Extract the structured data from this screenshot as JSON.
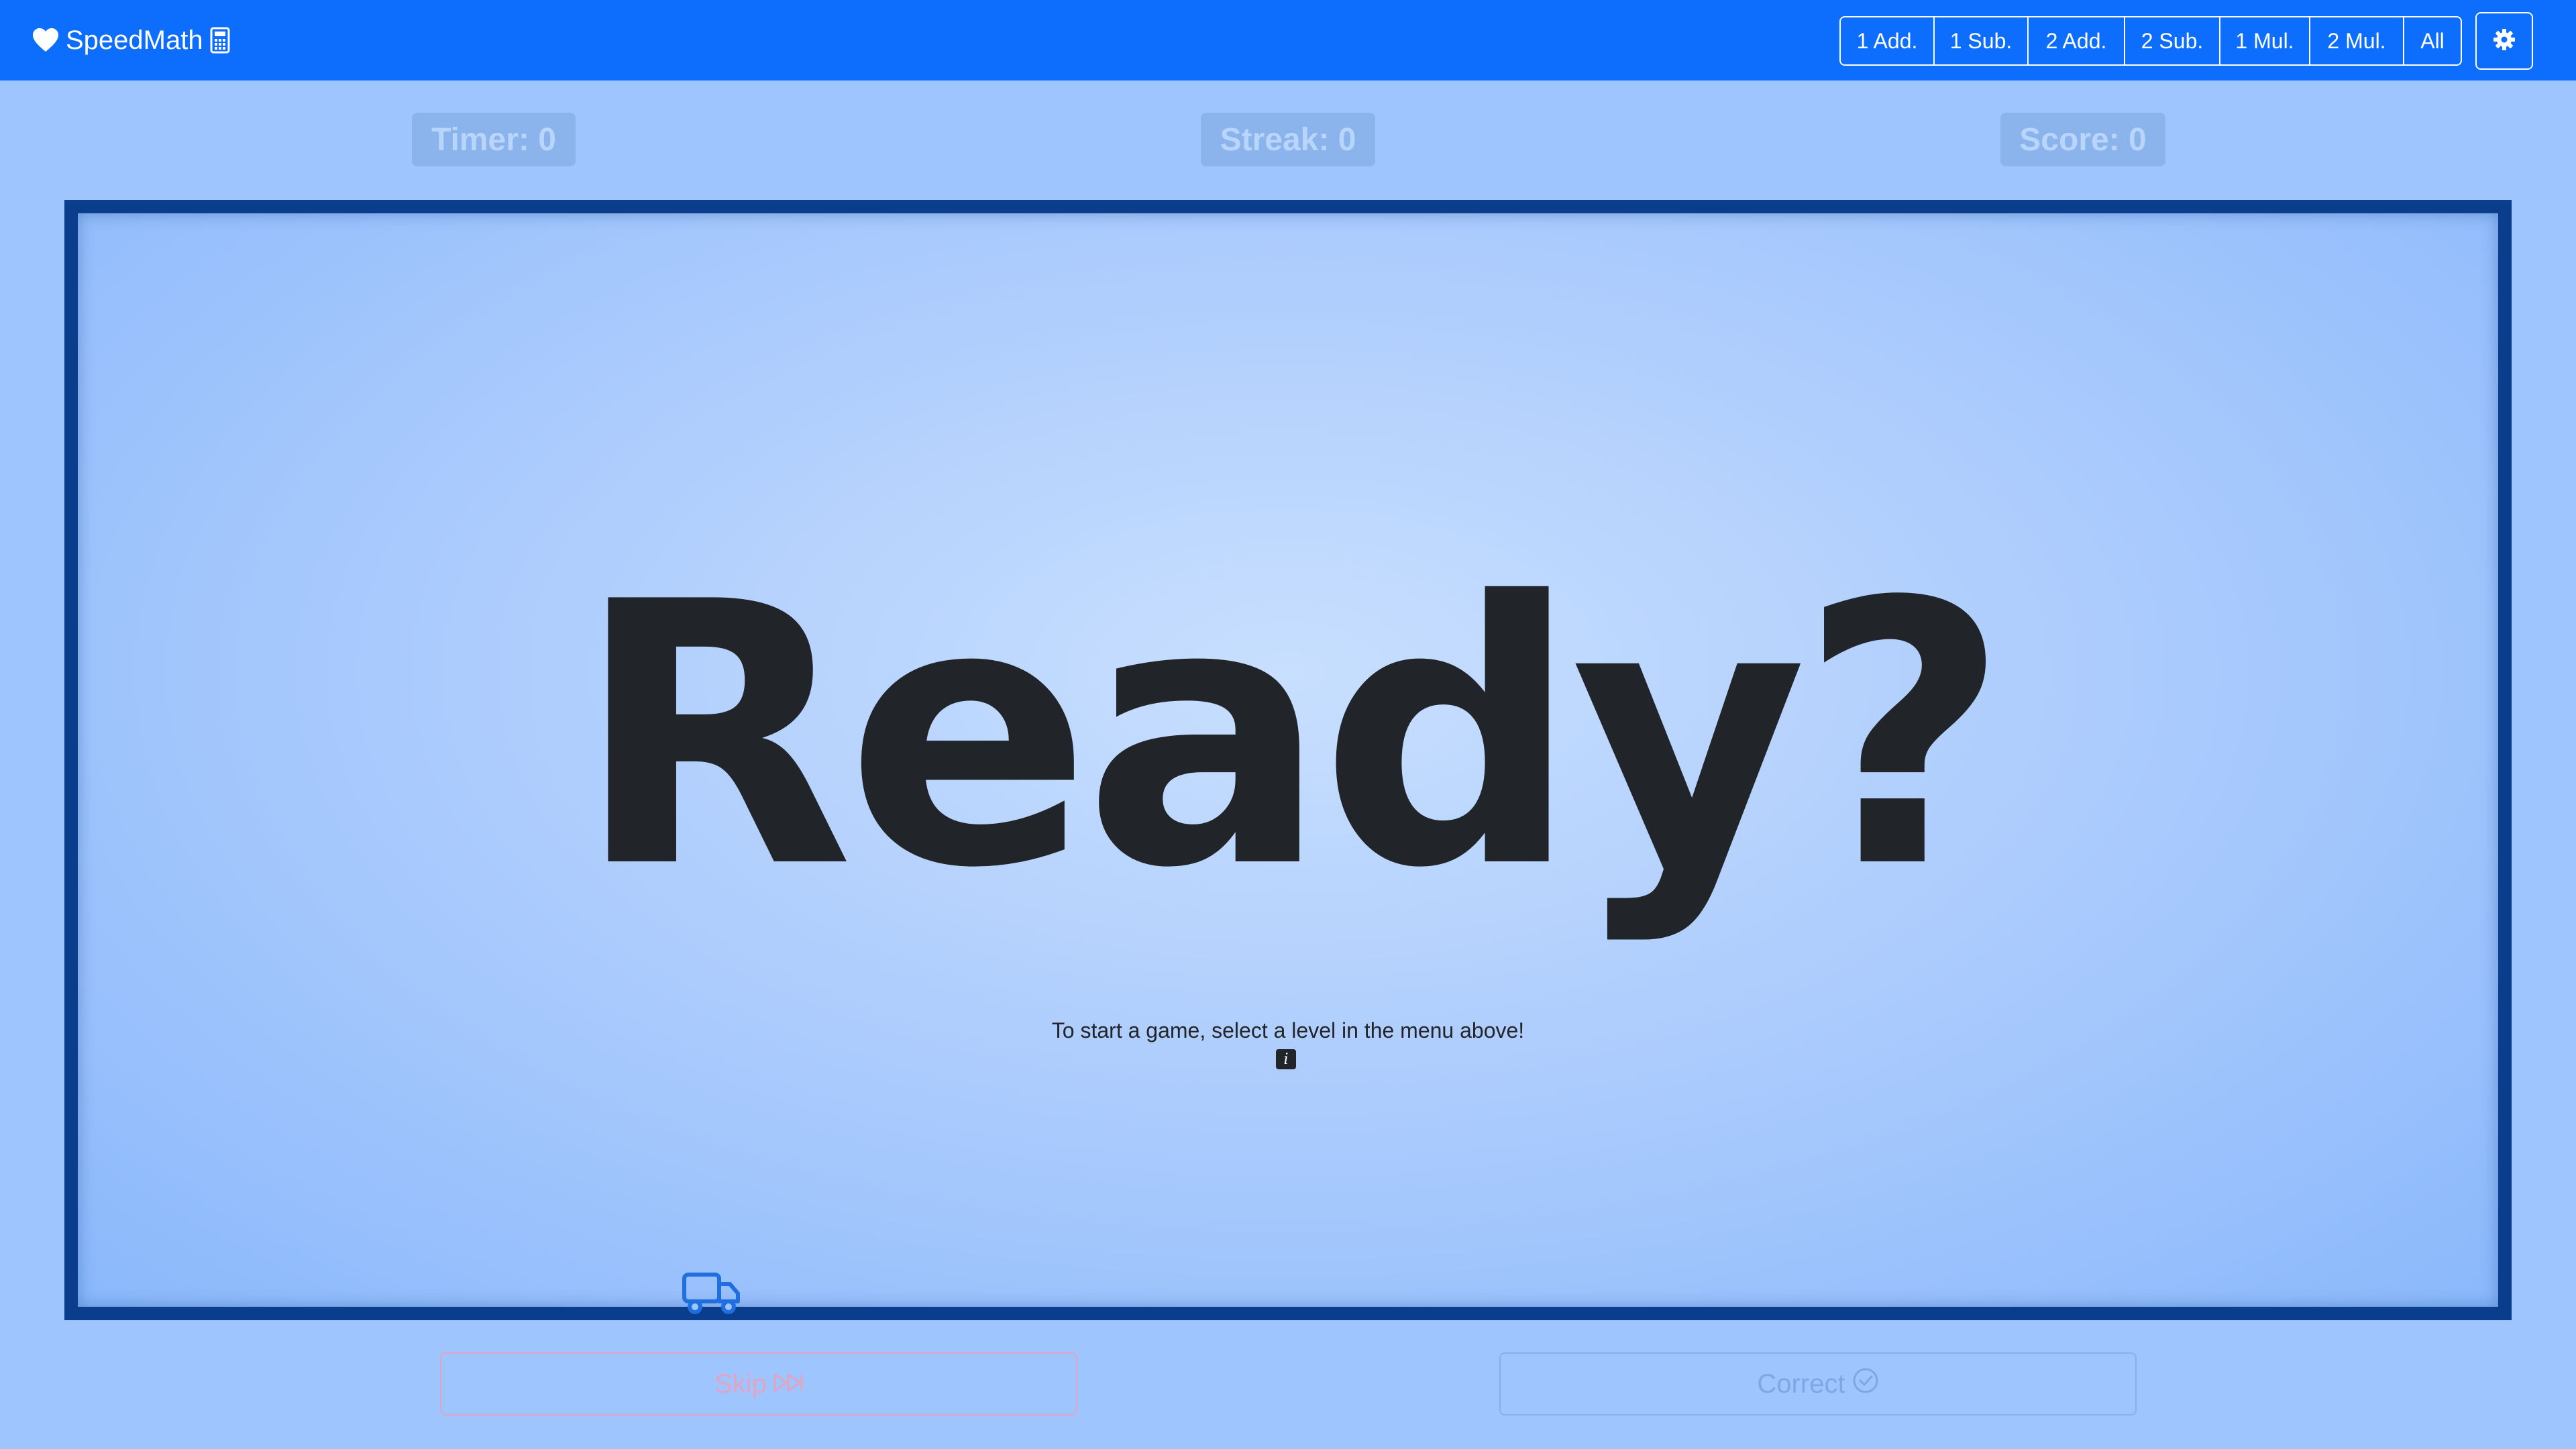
{
  "navbar": {
    "brand_label": "SpeedMath",
    "brand_icons": [
      "heart-icon",
      "calculator-icon"
    ],
    "levels": [
      {
        "label": "1 Add."
      },
      {
        "label": "1 Sub."
      },
      {
        "label": "2 Add."
      },
      {
        "label": "2 Sub."
      },
      {
        "label": "1 Mul."
      },
      {
        "label": "2 Mul."
      },
      {
        "label": "All"
      }
    ],
    "settings_icon": "gear-icon"
  },
  "stats": {
    "timer": "Timer: 0",
    "streak": "Streak: 0",
    "score": "Score: 0"
  },
  "game": {
    "headline": "Ready?",
    "hint": "To start a game, select a level in the menu above!",
    "info_glyph": "i",
    "progress_icon": "truck-icon"
  },
  "actions": {
    "skip_label": "Skip",
    "skip_icon": "fast-forward-icon",
    "correct_label": "Correct",
    "correct_icon": "check-circle-icon"
  },
  "colors": {
    "navbar": "#0d6efd",
    "page_background": "#9ec5fe",
    "panel_border": "#0a3d8c",
    "text_dark": "#212529"
  }
}
